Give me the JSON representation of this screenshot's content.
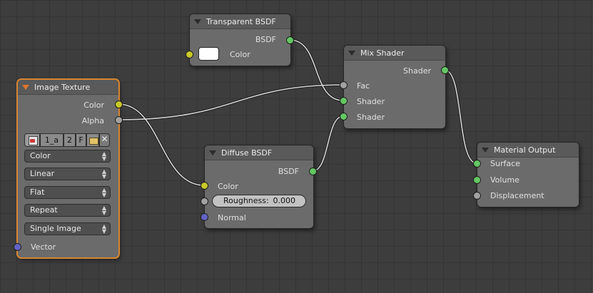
{
  "nodes": {
    "image_texture": {
      "title": "Image Texture",
      "outputs": [
        "Color",
        "Alpha"
      ],
      "image_bar": {
        "name": "1_a",
        "users": "2",
        "fake": "F"
      },
      "dropdowns": [
        "Color",
        "Linear",
        "Flat",
        "Repeat",
        "Single Image"
      ],
      "inputs": [
        "Vector"
      ]
    },
    "transparent_bsdf": {
      "title": "Transparent BSDF",
      "outputs": [
        "BSDF"
      ],
      "inputs": [
        "Color"
      ],
      "color_value": "#ffffff"
    },
    "mix_shader": {
      "title": "Mix Shader",
      "outputs": [
        "Shader"
      ],
      "inputs": [
        "Fac",
        "Shader",
        "Shader"
      ]
    },
    "diffuse_bsdf": {
      "title": "Diffuse BSDF",
      "outputs": [
        "BSDF"
      ],
      "inputs": [
        "Color",
        "Normal"
      ],
      "roughness_label": "Roughness:",
      "roughness_value": "0.000"
    },
    "material_output": {
      "title": "Material Output",
      "inputs": [
        "Surface",
        "Volume",
        "Displacement"
      ]
    }
  },
  "colors": {
    "shader_socket": "#63c763",
    "color_socket": "#c7c729",
    "float_socket": "#a1a1a1",
    "vector_socket": "#6363c7",
    "selected_border": "#d9852f"
  }
}
